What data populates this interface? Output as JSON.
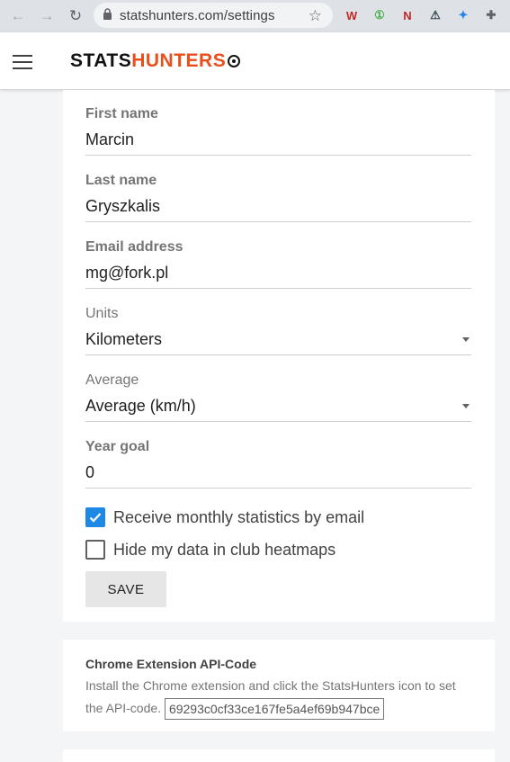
{
  "browser": {
    "url": "statshunters.com/settings",
    "nav": {
      "back": "←",
      "forward": "→",
      "reload": "↻"
    },
    "star": "☆",
    "extensions": [
      "W",
      "①",
      "N",
      "⚠",
      "✦",
      "✚"
    ]
  },
  "header": {
    "logo_part1": "STATS",
    "logo_part2": "HUNTERS",
    "brand_color": "#e94e1b"
  },
  "form": {
    "first_name": {
      "label": "First name",
      "value": "Marcin"
    },
    "last_name": {
      "label": "Last name",
      "value": "Gryszkalis"
    },
    "email": {
      "label": "Email address",
      "value": "mg@fork.pl"
    },
    "units": {
      "label": "Units",
      "value": "Kilometers"
    },
    "average": {
      "label": "Average",
      "value": "Average (km/h)"
    },
    "year_goal": {
      "label": "Year goal",
      "value": "0"
    },
    "monthly_stats": {
      "label": "Receive monthly statistics by email",
      "checked": true
    },
    "hide_heatmaps": {
      "label": "Hide my data in club heatmaps",
      "checked": false
    },
    "save_label": "SAVE"
  },
  "api": {
    "title": "Chrome Extension API-Code",
    "description": "Install the Chrome extension and click the StatsHunters icon to set the API-code.",
    "code": "69293c0cf33ce167fe5a4ef69b947bce"
  },
  "colors": {
    "checkbox": "#1e88e5"
  }
}
